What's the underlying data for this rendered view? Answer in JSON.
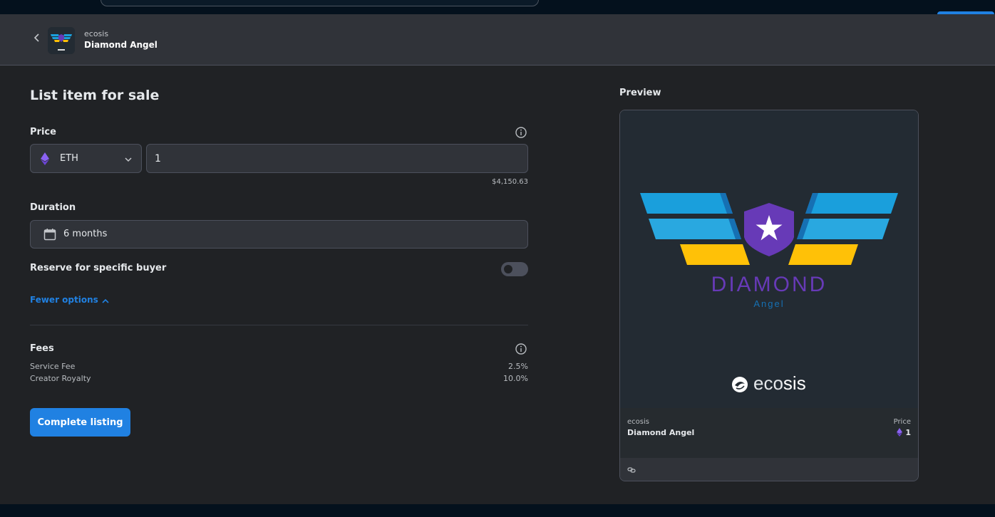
{
  "header": {
    "collection": "ecosis",
    "item_name": "Diamond Angel"
  },
  "form": {
    "title": "List item for sale",
    "price_label": "Price",
    "currency": "ETH",
    "price_value": "1",
    "usd_value": "$4,150.63",
    "duration_label": "Duration",
    "duration_value": "6 months",
    "reserve_label": "Reserve for specific buyer",
    "reserve_enabled": false,
    "fewer_options": "Fewer options",
    "fees_label": "Fees",
    "fees": [
      {
        "label": "Service Fee",
        "value": "2.5%"
      },
      {
        "label": "Creator Royalty",
        "value": "10.0%"
      }
    ],
    "complete_button": "Complete listing"
  },
  "preview": {
    "label": "Preview",
    "art_title": "DIAMOND",
    "art_subtitle": "Angel",
    "brand_prefix": "eco",
    "brand_suffix": "sis",
    "collection": "ecosis",
    "name": "Diamond Angel",
    "price_label": "Price",
    "price_value": "1"
  },
  "colors": {
    "accent": "#2081e2",
    "background": "#202225",
    "surface": "#303339",
    "eth_purple": "#8a62f2",
    "wing_blue": "#1a9fdc",
    "wing_gold": "#ffc107",
    "shield_purple": "#673ab7"
  },
  "icons": [
    "back-icon",
    "ethereum-icon",
    "chevron-down-icon",
    "info-icon",
    "calendar-icon",
    "chevron-up-icon",
    "link-icon",
    "ecosis-logo-icon"
  ]
}
